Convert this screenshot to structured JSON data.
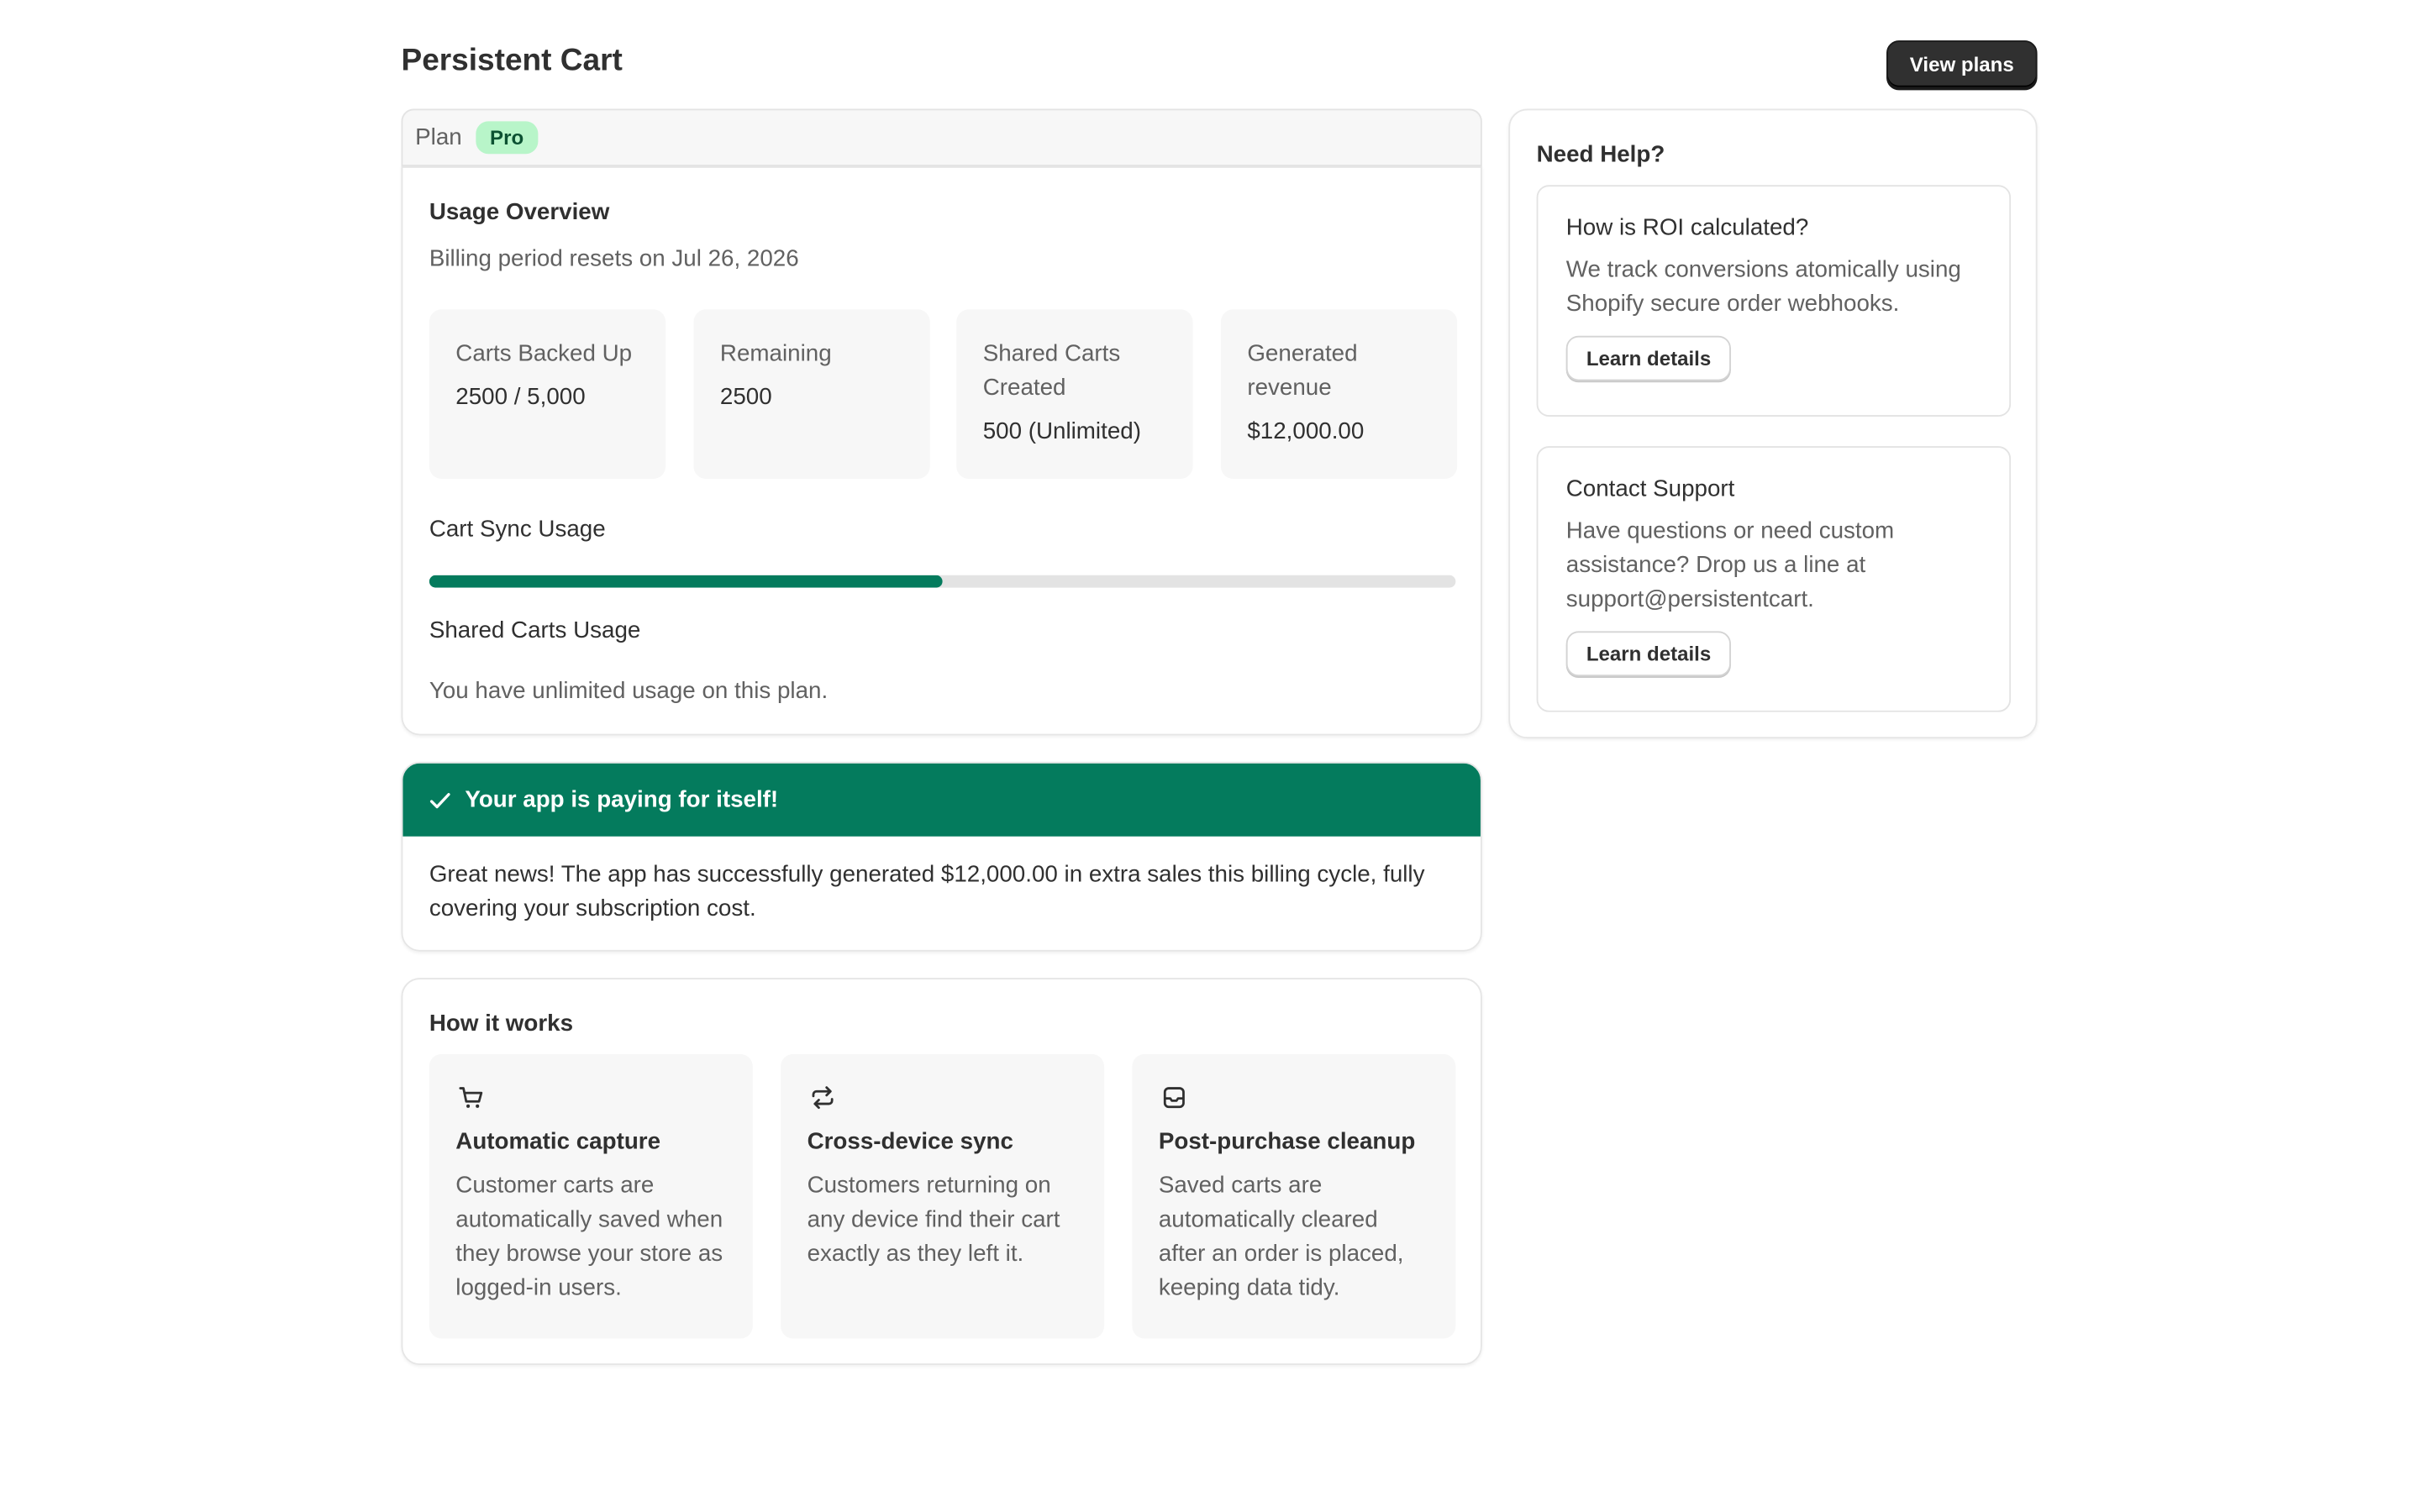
{
  "header": {
    "title": "Persistent Cart",
    "view_plans_label": "View plans"
  },
  "plan": {
    "label": "Plan",
    "badge": "Pro"
  },
  "usage": {
    "heading": "Usage Overview",
    "billing_text": "Billing period resets on Jul 26, 2026",
    "stats": [
      {
        "label": "Carts Backed Up",
        "value": "2500 / 5,000"
      },
      {
        "label": "Remaining",
        "value": "2500"
      },
      {
        "label": "Shared Carts Created",
        "value": "500 (Unlimited)"
      },
      {
        "label": "Generated revenue",
        "value": "$12,000.00"
      }
    ],
    "cart_sync_label": "Cart Sync Usage",
    "cart_sync_progress": 0.5,
    "shared_carts_label": "Shared Carts Usage",
    "shared_carts_text": "You have unlimited usage on this plan."
  },
  "banner": {
    "title": "Your app is paying for itself!",
    "body": "Great news! The app has successfully generated $12,000.00 in extra sales this billing cycle, fully covering your subscription cost."
  },
  "how_it_works": {
    "heading": "How it works",
    "features": [
      {
        "icon": "cart-icon",
        "title": "Automatic capture",
        "desc": "Customer carts are automatically saved when they browse your store as logged-in users."
      },
      {
        "icon": "sync-icon",
        "title": "Cross-device sync",
        "desc": "Customers returning on any device find their cart exactly as they left it."
      },
      {
        "icon": "inbox-icon",
        "title": "Post-purchase cleanup",
        "desc": "Saved carts are automatically cleared after an order is placed, keeping data tidy."
      }
    ]
  },
  "help": {
    "heading": "Need Help?",
    "items": [
      {
        "title": "How is ROI calculated?",
        "desc": "We track conversions atomically using Shopify secure order webhooks.",
        "button": "Learn details"
      },
      {
        "title": "Contact Support",
        "desc": "Have questions or need custom assistance? Drop us a line at support@persistentcart.",
        "button": "Learn details"
      }
    ]
  },
  "colors": {
    "accent": "#047b5d",
    "badge_bg": "#b8f5c9",
    "primary_button": "#303030"
  }
}
